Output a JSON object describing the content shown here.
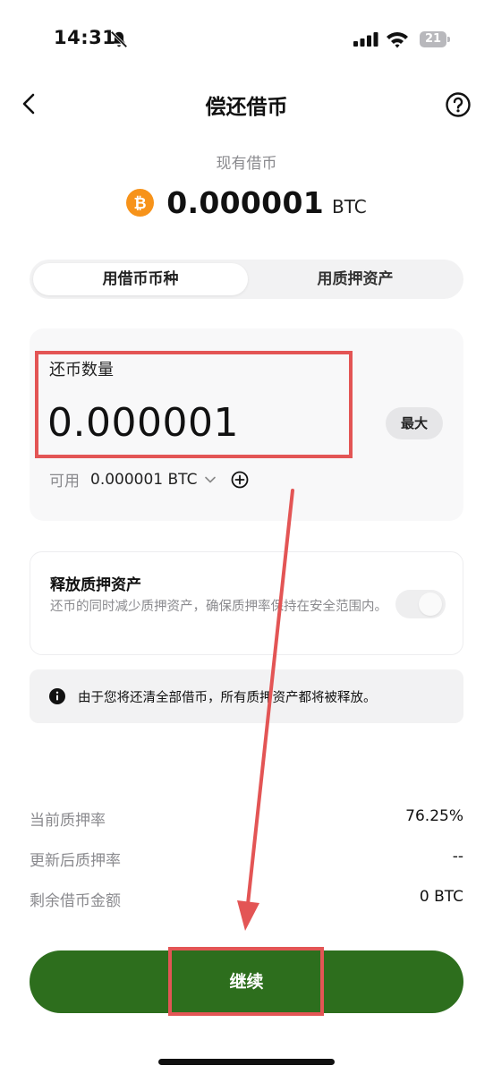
{
  "status_bar": {
    "time": "14:31",
    "battery": "21",
    "icons": [
      "bell-slash-icon",
      "signal-icon",
      "wifi-icon",
      "battery-icon"
    ]
  },
  "nav": {
    "title": "偿还借币",
    "back_icon": "back-arrow-icon",
    "help_icon": "help-icon"
  },
  "debt": {
    "label": "现有借币",
    "amount": "0.000001",
    "unit": "BTC",
    "coin_icon": "bitcoin-icon",
    "coin_color": "#f7931a"
  },
  "tabs": [
    {
      "label": "用借币币种",
      "active": true
    },
    {
      "label": "用质押资产",
      "active": false
    }
  ],
  "repay": {
    "label": "还币数量",
    "value": "0.000001",
    "max_label": "最大",
    "available_label": "可用",
    "available_value": "0.000001 BTC"
  },
  "release": {
    "title": "释放质押资产",
    "description": "还币的同时减少质押资产，确保质押率保持在安全范围内。",
    "toggle_on": false
  },
  "notice": {
    "text": "由于您将还清全部借币，所有质押资产都将被释放。"
  },
  "summary": [
    {
      "label": "当前质押率",
      "value": "76.25%"
    },
    {
      "label": "更新后质押率",
      "value": "--"
    },
    {
      "label": "剩余借币金额",
      "value": "0 BTC"
    }
  ],
  "primary_button": {
    "label": "继续",
    "color": "#2d6e1d"
  },
  "annotation_color": "#e35555"
}
